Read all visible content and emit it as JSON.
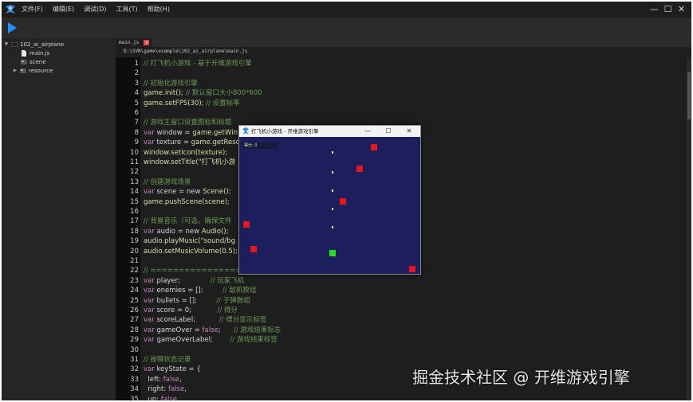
{
  "app": {
    "menu": [
      "文件(F)",
      "编辑(E)",
      "调试(D)",
      "工具(T)",
      "帮助(H)"
    ],
    "window_controls": [
      "—",
      "☐",
      "✕"
    ],
    "toolbar": {
      "run_icon": "play-icon"
    },
    "colors": {
      "accent_blue": "#1e90ff",
      "background": "#1e1e1e"
    }
  },
  "sidebar": {
    "root": "102_ai_airplane",
    "items": [
      {
        "label": "main.js",
        "icon": "file-icon"
      },
      {
        "label": "scene",
        "icon": "scene-icon"
      },
      {
        "label": "resource",
        "icon": "folder-icon"
      }
    ]
  },
  "editor": {
    "tab": "main.js",
    "path": "D:\\SVN\\game\\example\\102_ai_airplane\\main.js",
    "lines": [
      {
        "n": "1",
        "tokens": [
          {
            "t": "// 打飞机小游戏 - 基于开维游戏引擎",
            "c": "cm"
          }
        ]
      },
      {
        "n": "2",
        "tokens": []
      },
      {
        "n": "3",
        "tokens": [
          {
            "t": "// 初始化游戏引擎",
            "c": "cm"
          }
        ]
      },
      {
        "n": "4",
        "tokens": [
          {
            "t": "game.init(); ",
            "c": "fn"
          },
          {
            "t": "// 默认窗口大小800*600",
            "c": "cm"
          }
        ]
      },
      {
        "n": "5",
        "tokens": [
          {
            "t": "game.setFPS(30); ",
            "c": "fn"
          },
          {
            "t": "// 设置帧率",
            "c": "cm"
          }
        ]
      },
      {
        "n": "6",
        "tokens": []
      },
      {
        "n": "7",
        "tokens": [
          {
            "t": "// 游戏主窗口设置图标和标题",
            "c": "cm"
          }
        ]
      },
      {
        "n": "8",
        "tokens": [
          {
            "t": "var ",
            "c": "kw"
          },
          {
            "t": "window = ",
            "c": ""
          },
          {
            "t": "game.getWin",
            "c": "fn"
          }
        ]
      },
      {
        "n": "9",
        "tokens": [
          {
            "t": "var ",
            "c": "kw"
          },
          {
            "t": "texture = ",
            "c": ""
          },
          {
            "t": "game.getReso",
            "c": "fn"
          }
        ]
      },
      {
        "n": "10",
        "tokens": [
          {
            "t": "window.setIcon(texture);",
            "c": "fn"
          }
        ]
      },
      {
        "n": "11",
        "tokens": [
          {
            "t": "window.setTitle(\"打飞机小游",
            "c": "fn"
          }
        ]
      },
      {
        "n": "12",
        "tokens": []
      },
      {
        "n": "13",
        "tokens": [
          {
            "t": "// 创建游戏场景",
            "c": "cm"
          }
        ]
      },
      {
        "n": "14",
        "tokens": [
          {
            "t": "var ",
            "c": "kw"
          },
          {
            "t": "scene = new ",
            "c": ""
          },
          {
            "t": "Scene();",
            "c": "fn"
          }
        ]
      },
      {
        "n": "15",
        "tokens": [
          {
            "t": "game.pushScene(scene);",
            "c": "fn"
          }
        ]
      },
      {
        "n": "16",
        "tokens": []
      },
      {
        "n": "17",
        "tokens": [
          {
            "t": "// 背景音乐（可选，确保文件",
            "c": "cm"
          }
        ]
      },
      {
        "n": "18",
        "tokens": [
          {
            "t": "var ",
            "c": "kw"
          },
          {
            "t": "audio = new ",
            "c": ""
          },
          {
            "t": "Audio();",
            "c": "fn"
          }
        ]
      },
      {
        "n": "19",
        "tokens": [
          {
            "t": "audio.playMusic(\"sound/bg",
            "c": "fn"
          }
        ]
      },
      {
        "n": "20",
        "tokens": [
          {
            "t": "audio.setMusicVolume(0.5);",
            "c": "fn"
          }
        ]
      },
      {
        "n": "21",
        "tokens": []
      },
      {
        "n": "22",
        "tokens": [
          {
            "t": "// ==================",
            "c": "cm"
          }
        ]
      },
      {
        "n": "23",
        "tokens": [
          {
            "t": "var ",
            "c": "kw"
          },
          {
            "t": "player;              ",
            "c": ""
          },
          {
            "t": "// 玩家飞机",
            "c": "cm"
          }
        ]
      },
      {
        "n": "24",
        "tokens": [
          {
            "t": "var ",
            "c": "kw"
          },
          {
            "t": "enemies = [];         ",
            "c": ""
          },
          {
            "t": "// 敌机数组",
            "c": "cm"
          }
        ]
      },
      {
        "n": "25",
        "tokens": [
          {
            "t": "var ",
            "c": "kw"
          },
          {
            "t": "bullets = [];         ",
            "c": ""
          },
          {
            "t": "// 子弹数组",
            "c": "cm"
          }
        ]
      },
      {
        "n": "26",
        "tokens": [
          {
            "t": "var ",
            "c": "kw"
          },
          {
            "t": "score = 0;            ",
            "c": ""
          },
          {
            "t": "// 得分",
            "c": "cm"
          }
        ]
      },
      {
        "n": "27",
        "tokens": [
          {
            "t": "var ",
            "c": "kw"
          },
          {
            "t": "scoreLabel;           ",
            "c": ""
          },
          {
            "t": "// 得分显示标签",
            "c": "cm"
          }
        ]
      },
      {
        "n": "28",
        "tokens": [
          {
            "t": "var ",
            "c": "kw"
          },
          {
            "t": "gameOver = ",
            "c": ""
          },
          {
            "t": "false",
            "c": "kw"
          },
          {
            "t": ";      ",
            "c": ""
          },
          {
            "t": "// 游戏结束标志",
            "c": "cm"
          }
        ]
      },
      {
        "n": "29",
        "tokens": [
          {
            "t": "var ",
            "c": "kw"
          },
          {
            "t": "gameOverLabel;        ",
            "c": ""
          },
          {
            "t": "// 游戏结束标签",
            "c": "cm"
          }
        ]
      },
      {
        "n": "30",
        "tokens": []
      },
      {
        "n": "31",
        "tokens": [
          {
            "t": "// 按键状态记录",
            "c": "cm"
          }
        ]
      },
      {
        "n": "32",
        "tokens": [
          {
            "t": "var ",
            "c": "kw"
          },
          {
            "t": "keyState = {",
            "c": ""
          }
        ]
      },
      {
        "n": "33",
        "tokens": [
          {
            "t": "  left: ",
            "c": ""
          },
          {
            "t": "false",
            "c": "kw"
          },
          {
            "t": ",",
            "c": ""
          }
        ]
      },
      {
        "n": "34",
        "tokens": [
          {
            "t": "  right: ",
            "c": ""
          },
          {
            "t": "false",
            "c": "kw"
          },
          {
            "t": ",",
            "c": ""
          }
        ]
      },
      {
        "n": "35",
        "tokens": [
          {
            "t": "  up: ",
            "c": ""
          },
          {
            "t": "false",
            "c": "kw"
          },
          {
            "t": ",",
            "c": ""
          }
        ]
      }
    ]
  },
  "game_window": {
    "title": "打飞机小游戏 - 开维游戏引擎",
    "controls": [
      "—",
      "☐",
      "✕"
    ],
    "score_label": "得分: 0",
    "colors": {
      "background": "#1c1f5c",
      "enemy": "#e8161e",
      "player": "#22dd22",
      "bullet": "#f5e26a"
    }
  },
  "watermark": "掘金技术社区 @ 开维游戏引擎"
}
